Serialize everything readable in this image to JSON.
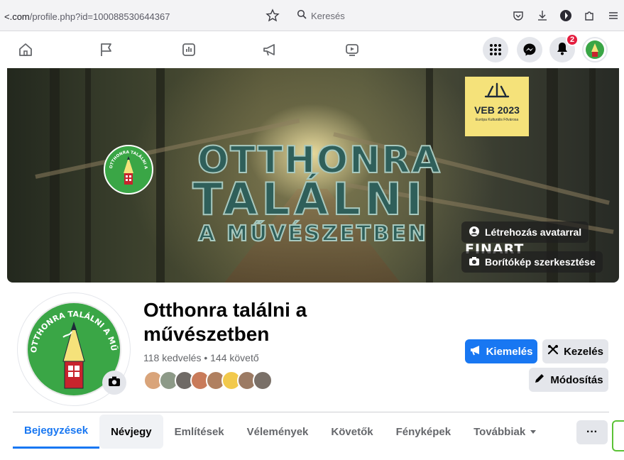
{
  "browser": {
    "url_prefix": "<.com",
    "url_path": "/profile.php?id=100088530644367",
    "search_placeholder": "Keresés"
  },
  "fb_nav": {
    "notification_count": "2",
    "icons": [
      "home-icon",
      "flag-icon",
      "ads-manager-icon",
      "megaphone-icon",
      "video-icon",
      "apps-grid-icon",
      "messenger-icon",
      "bell-icon"
    ]
  },
  "cover": {
    "title_line1": "OTTHONRA",
    "title_line2": "TALÁLNI",
    "title_line3": "A MŰVÉSZETBEN",
    "veb_year": "VEB 2023",
    "veb_sub": "Európa Kulturális Fővárosa",
    "logo_text": "OTTHONRA TALÁLNI A MŰVÉSZETBEN",
    "finart": "FINART",
    "avatar_button": "Létrehozás avatarral",
    "edit_cover_button": "Borítókép szerkesztése"
  },
  "profile": {
    "name": "Otthonra találni a művészetben",
    "stats": "118 kedvelés • 144 követő",
    "avatar_text": "OTTHONRA TALÁLNI A MŰVÉSZETBEN",
    "friend_face_colors": [
      "#d9a47a",
      "#8d9a88",
      "#6f6a66",
      "#c97b5a",
      "#b08060",
      "#f2c94c",
      "#9c7b64",
      "#7a7068"
    ]
  },
  "actions": {
    "promote": "Kiemelés",
    "manage": "Kezelés",
    "edit": "Módosítás"
  },
  "tabs": [
    {
      "label": "Bejegyzések"
    },
    {
      "label": "Névjegy"
    },
    {
      "label": "Említések"
    },
    {
      "label": "Vélemények"
    },
    {
      "label": "Követők"
    },
    {
      "label": "Fényképek"
    },
    {
      "label": "Továbbiak"
    }
  ],
  "more_button": "···",
  "colors": {
    "accent": "#1877f2",
    "badge": "#e41e3f",
    "logo_green": "#3aa646"
  }
}
